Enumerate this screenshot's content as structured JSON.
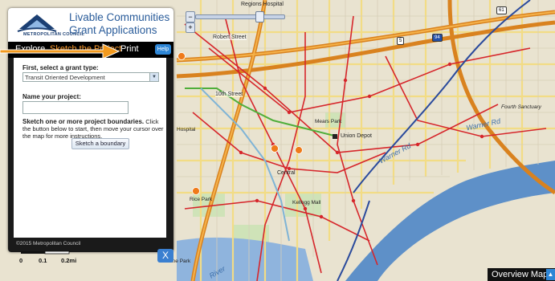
{
  "panel": {
    "logo_text": "METROPOLITAN COUNCIL",
    "title": "Livable Communities Grant Applications",
    "tabs": {
      "explore": "Explore",
      "sketch": "Sketch the Project",
      "print": "Print"
    },
    "help_label": "Help",
    "grant_type_label": "First, select a grant type:",
    "grant_type_value": "Transit Oriented Development",
    "project_name_label": "Name your project:",
    "project_name_value": "",
    "instructions_bold": "Sketch one or more project boundaries.",
    "instructions_text": " Click the button below to start, then move your cursor over the map for more instructions.",
    "sketch_button_label": "Sketch a boundary",
    "copyright": "©2015 Metropolitan Council",
    "close_label": "X"
  },
  "map": {
    "labels": {
      "regions_hospital": "Regions Hospital",
      "robert_street": "Robert Street",
      "tenth_street": "10th Street",
      "central": "Central",
      "union_depot": "Union Depot",
      "mears_park": "Mears Park",
      "warner_rd": "Warner Rd",
      "warner_rd_2": "Warner Rd",
      "fourth_sanctuary": "Fourth Sanctuary",
      "rice_park": "Rice Park",
      "kellogg_mall": "Kellogg Mall",
      "irvine_park": "Irvine Park",
      "river": "River",
      "hospital": "Hospital",
      "shield_61": "61",
      "shield_94": "94",
      "shield_5": "5"
    },
    "scale": {
      "zero": "0",
      "mid": "0.1",
      "end": "0.2mi"
    },
    "overview_label": "Overview Map",
    "colors": {
      "land": "#e9e3d0",
      "river": "#5e90c8",
      "freeway": "#d9821f",
      "arterial": "#f0d36d",
      "transit_red": "#d6262b",
      "transit_green": "#4fae3a",
      "transit_blue": "#2a4a9c",
      "panel_bg": "#1a1a1a",
      "accent_orange": "#ff9d2e",
      "title_blue": "#2a5c9a"
    }
  }
}
